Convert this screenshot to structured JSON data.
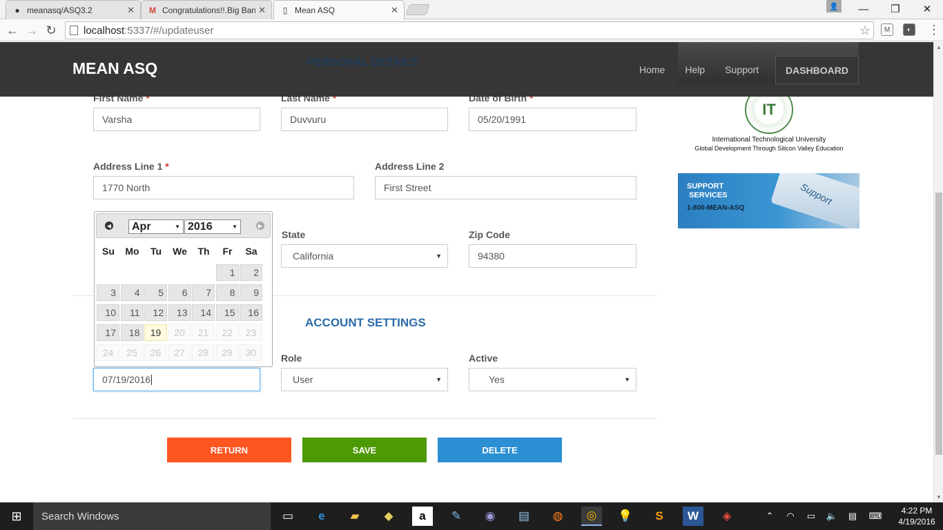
{
  "browser": {
    "tabs": [
      {
        "title": "meanasq/ASQ3.2",
        "icon": "github-icon"
      },
      {
        "title": "Congratulations!!.Big Bang",
        "icon": "gmail-icon"
      },
      {
        "title": "Mean ASQ",
        "icon": "page-icon"
      }
    ],
    "url_host": "localhost",
    "url_path": ":5337/#/updateuser"
  },
  "nav": {
    "brand": "MEAN ASQ",
    "links": [
      "Home",
      "Help",
      "Support"
    ],
    "dashboard": "DASHBOARD"
  },
  "personal": {
    "title": "PERSONAL DETAILS",
    "first_name_label": "First Name",
    "first_name": "Varsha",
    "last_name_label": "Last Name",
    "last_name": "Duvvuru",
    "dob_label": "Date of Birth",
    "dob": "05/20/1991",
    "addr1_label": "Address Line 1",
    "addr1": "1770 North",
    "addr2_label": "Address Line 2",
    "addr2": "First Street",
    "state_label": "State",
    "state": "California",
    "zip_label": "Zip Code",
    "zip": "94380",
    "required_mark": "*"
  },
  "account": {
    "title": "ACCOUNT SETTINGS",
    "date_value": "07/19/2016",
    "role_label": "Role",
    "role": "User",
    "active_label": "Active",
    "active": "Yes"
  },
  "buttons": {
    "return": "RETURN",
    "save": "SAVE",
    "delete": "DELETE"
  },
  "colors": {
    "return": "#ff5722",
    "save": "#4e9a06",
    "delete": "#2d8fd3",
    "navbar": "#363636",
    "section_title": "#2a6aa8"
  },
  "sidebar": {
    "itu_name": "International Technological University",
    "itu_tag": "Global Development Through Silicon Valley Education",
    "support_line1": "SUPPORT",
    "support_line2": "SERVICES",
    "support_phone": "1-800-MEAN-ASQ",
    "support_key": "Support"
  },
  "datepicker": {
    "month": "Apr",
    "year": "2016",
    "weekdays": [
      "Su",
      "Mo",
      "Tu",
      "We",
      "Th",
      "Fr",
      "Sa"
    ],
    "rows": [
      [
        null,
        null,
        null,
        null,
        null,
        "1",
        "2"
      ],
      [
        "3",
        "4",
        "5",
        "6",
        "7",
        "8",
        "9"
      ],
      [
        "10",
        "11",
        "12",
        "13",
        "14",
        "15",
        "16"
      ],
      [
        "17",
        "18",
        "19",
        "20",
        "21",
        "22",
        "23"
      ],
      [
        "24",
        "25",
        "26",
        "27",
        "28",
        "29",
        "30"
      ]
    ],
    "today": "19",
    "last_enabled": "19"
  },
  "taskbar": {
    "search_placeholder": "Search Windows",
    "time": "4:22 PM",
    "date": "4/19/2016"
  }
}
